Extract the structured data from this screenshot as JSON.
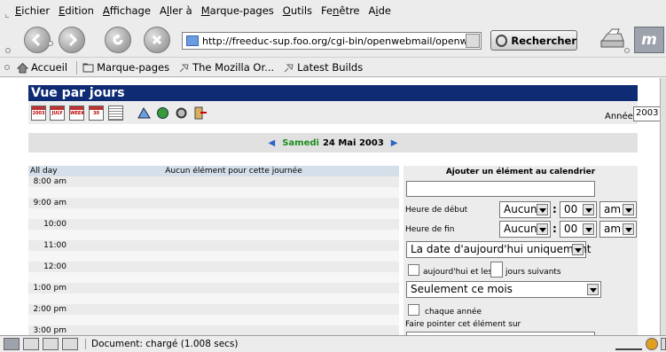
{
  "menubar": {
    "items": [
      {
        "underlined": "E",
        "rest": "ichier"
      },
      {
        "underlined": "E",
        "rest": "dition"
      },
      {
        "underlined": "A",
        "rest": "ffichage"
      },
      {
        "prefix": "A",
        "underlined": "l",
        "rest": "ler à"
      },
      {
        "underlined": "M",
        "rest": "arque-pages"
      },
      {
        "underlined": "O",
        "rest": "utils"
      },
      {
        "prefix": "Fe",
        "underlined": "n",
        "rest": "être"
      },
      {
        "prefix": "A",
        "underlined": "i",
        "rest": "de"
      }
    ]
  },
  "navbar": {
    "url": "http://freeduc-sup.foo.org/cgi-bin/openwebmail/openwebm",
    "search_label": "Rechercher",
    "throbber_label": "m"
  },
  "bookmarks": {
    "items": [
      "Accueil",
      "Marque-pages",
      "The Mozilla Or...",
      "Latest Builds"
    ]
  },
  "page": {
    "title": "Vue par jours",
    "year_label": "Année",
    "year_value": "2003",
    "day_name": "Samedi",
    "date": "24 Mai 2003",
    "table_header": {
      "time": "All day",
      "note": "Aucun élément pour cette journée"
    },
    "times": [
      "8:00 am",
      "",
      "9:00 am",
      "",
      "10:00 am",
      "",
      "11:00 am",
      "",
      "12:00 pm",
      "",
      "1:00 pm",
      "",
      "2:00 pm",
      "",
      "3:00 pm"
    ],
    "add_panel": {
      "title": "Ajouter un élément au calendrier",
      "start_label": "Heure de début",
      "end_label": "Heure de fin",
      "hour_value": "Aucun",
      "minute_value": "00",
      "ampm_value": "am",
      "date_option": "La date d'aujourd'hui uniquement",
      "today_and": "aujourd'hui et les",
      "following_days": "jours suivants",
      "month_option": "Seulement ce mois",
      "every_year": "chaque année",
      "point_label": "Faire pointer cet élément sur"
    }
  },
  "statusbar": {
    "text": "Document: chargé (1.008 secs)"
  }
}
